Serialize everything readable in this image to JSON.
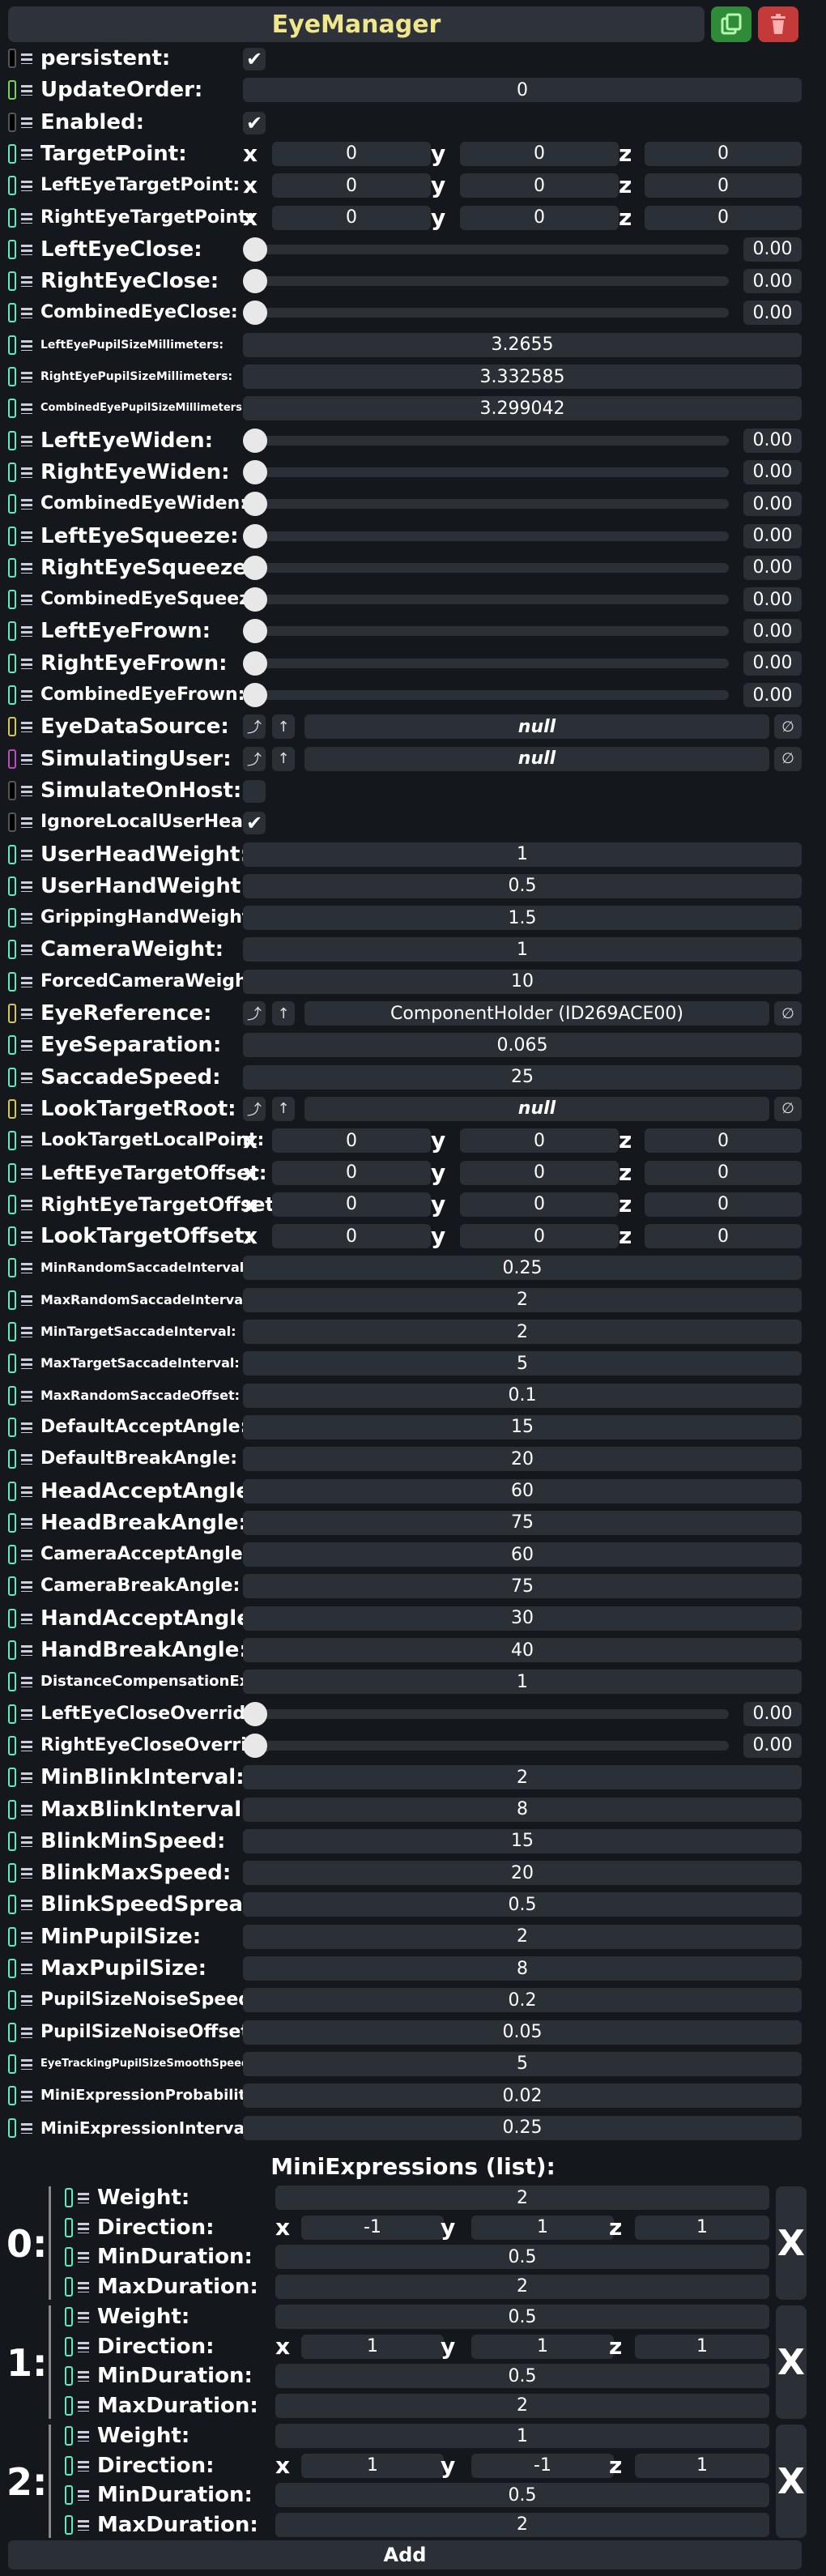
{
  "title": "EyeManager",
  "fields": [
    {
      "label": "persistent:",
      "kind": "check",
      "value": "✔",
      "sw": "#777",
      "fs": 26
    },
    {
      "label": "UpdateOrder:",
      "kind": "num",
      "value": "0",
      "sw": "#7cd44a",
      "fs": 26
    },
    {
      "label": "Enabled:",
      "kind": "check",
      "value": "✔",
      "sw": "#777",
      "fs": 26
    },
    {
      "label": "TargetPoint:",
      "kind": "vec",
      "x": "0",
      "y": "0",
      "z": "0",
      "fs": 26
    },
    {
      "label": "LeftEyeTargetPoint:",
      "kind": "vec",
      "x": "0",
      "y": "0",
      "z": "0",
      "fs": 22
    },
    {
      "label": "RightEyeTargetPoint:",
      "kind": "vec",
      "x": "0",
      "y": "0",
      "z": "0",
      "fs": 22
    },
    {
      "label": "LeftEyeClose:",
      "kind": "slider",
      "value": "0.00",
      "fs": 26
    },
    {
      "label": "RightEyeClose:",
      "kind": "slider",
      "value": "0.00",
      "fs": 26
    },
    {
      "label": "CombinedEyeClose:",
      "kind": "slider",
      "value": "0.00",
      "fs": 22
    },
    {
      "label": "LeftEyePupilSizeMillimeters:",
      "kind": "num",
      "value": "3.2655",
      "fs": 14
    },
    {
      "label": "RightEyePupilSizeMillimeters:",
      "kind": "num",
      "value": "3.332585",
      "fs": 14
    },
    {
      "label": "CombinedEyePupilSizeMillimeters:",
      "kind": "num",
      "value": "3.299042",
      "fs": 13
    },
    {
      "label": "LeftEyeWiden:",
      "kind": "slider",
      "value": "0.00",
      "fs": 26
    },
    {
      "label": "RightEyeWiden:",
      "kind": "slider",
      "value": "0.00",
      "fs": 26
    },
    {
      "label": "CombinedEyeWiden:",
      "kind": "slider",
      "value": "0.00",
      "fs": 22
    },
    {
      "label": "LeftEyeSqueeze:",
      "kind": "slider",
      "value": "0.00",
      "fs": 26
    },
    {
      "label": "RightEyeSqueeze:",
      "kind": "slider",
      "value": "0.00",
      "fs": 26
    },
    {
      "label": "CombinedEyeSqueeze:",
      "kind": "slider",
      "value": "0.00",
      "fs": 22
    },
    {
      "label": "LeftEyeFrown:",
      "kind": "slider",
      "value": "0.00",
      "fs": 26
    },
    {
      "label": "RightEyeFrown:",
      "kind": "slider",
      "value": "0.00",
      "fs": 26
    },
    {
      "label": "CombinedEyeFrown:",
      "kind": "slider",
      "value": "0.00",
      "fs": 22
    },
    {
      "label": "EyeDataSource:",
      "kind": "ref",
      "value": "null",
      "sw": "#d6c94a",
      "fs": 26
    },
    {
      "label": "SimulatingUser:",
      "kind": "ref",
      "value": "null",
      "sw": "#c04ab8",
      "fs": 26
    },
    {
      "label": "SimulateOnHost:",
      "kind": "check",
      "value": "",
      "sw": "#777",
      "fs": 26
    },
    {
      "label": "IgnoreLocalUserHead:",
      "kind": "check",
      "value": "✔",
      "sw": "#777",
      "fs": 22
    },
    {
      "label": "UserHeadWeight:",
      "kind": "num",
      "value": "1",
      "fs": 26
    },
    {
      "label": "UserHandWeight:",
      "kind": "num",
      "value": "0.5",
      "fs": 26
    },
    {
      "label": "GrippingHandWeight:",
      "kind": "num",
      "value": "1.5",
      "fs": 22
    },
    {
      "label": "CameraWeight:",
      "kind": "num",
      "value": "1",
      "fs": 26
    },
    {
      "label": "ForcedCameraWeight:",
      "kind": "num",
      "value": "10",
      "fs": 22
    },
    {
      "label": "EyeReference:",
      "kind": "ref",
      "value": "ComponentHolder (ID269ACE00)",
      "sw": "#d6c94a",
      "fs": 26
    },
    {
      "label": "EyeSeparation:",
      "kind": "num",
      "value": "0.065",
      "fs": 26
    },
    {
      "label": "SaccadeSpeed:",
      "kind": "num",
      "value": "25",
      "fs": 26
    },
    {
      "label": "LookTargetRoot:",
      "kind": "ref",
      "value": "null",
      "sw": "#d6c94a",
      "fs": 26
    },
    {
      "label": "LookTargetLocalPoint:",
      "kind": "vec",
      "x": "0",
      "y": "0",
      "z": "0",
      "fs": 22
    },
    {
      "label": "LeftEyeTargetOffset:",
      "kind": "vec",
      "x": "0",
      "y": "0",
      "z": "0",
      "fs": 24
    },
    {
      "label": "RightEyeTargetOffset:",
      "kind": "vec",
      "x": "0",
      "y": "0",
      "z": "0",
      "fs": 24
    },
    {
      "label": "LookTargetOffset:",
      "kind": "vec",
      "x": "0",
      "y": "0",
      "z": "0",
      "fs": 26
    },
    {
      "label": "MinRandomSaccadeInterval:",
      "kind": "num",
      "value": "0.25",
      "fs": 16
    },
    {
      "label": "MaxRandomSaccadeInterval:",
      "kind": "num",
      "value": "2",
      "fs": 16
    },
    {
      "label": "MinTargetSaccadeInterval:",
      "kind": "num",
      "value": "2",
      "fs": 16
    },
    {
      "label": "MaxTargetSaccadeInterval:",
      "kind": "num",
      "value": "5",
      "fs": 16
    },
    {
      "label": "MaxRandomSaccadeOffset:",
      "kind": "num",
      "value": "0.1",
      "fs": 16
    },
    {
      "label": "DefaultAcceptAngle:",
      "kind": "num",
      "value": "15",
      "fs": 22
    },
    {
      "label": "DefaultBreakAngle:",
      "kind": "num",
      "value": "20",
      "fs": 22
    },
    {
      "label": "HeadAcceptAngle:",
      "kind": "num",
      "value": "60",
      "fs": 26
    },
    {
      "label": "HeadBreakAngle:",
      "kind": "num",
      "value": "75",
      "fs": 26
    },
    {
      "label": "CameraAcceptAngle:",
      "kind": "num",
      "value": "60",
      "fs": 22
    },
    {
      "label": "CameraBreakAngle:",
      "kind": "num",
      "value": "75",
      "fs": 22
    },
    {
      "label": "HandAcceptAngle:",
      "kind": "num",
      "value": "30",
      "fs": 26
    },
    {
      "label": "HandBreakAngle:",
      "kind": "num",
      "value": "40",
      "fs": 26
    },
    {
      "label": "DistanceCompensationExp:",
      "kind": "num",
      "value": "1",
      "fs": 18
    },
    {
      "label": "LeftEyeCloseOverride:",
      "kind": "slider",
      "value": "0.00",
      "fs": 22
    },
    {
      "label": "RightEyeCloseOverride:",
      "kind": "slider",
      "value": "0.00",
      "fs": 22
    },
    {
      "label": "MinBlinkInterval:",
      "kind": "num",
      "value": "2",
      "fs": 26
    },
    {
      "label": "MaxBlinkInterval:",
      "kind": "num",
      "value": "8",
      "fs": 26
    },
    {
      "label": "BlinkMinSpeed:",
      "kind": "num",
      "value": "15",
      "fs": 26
    },
    {
      "label": "BlinkMaxSpeed:",
      "kind": "num",
      "value": "20",
      "fs": 26
    },
    {
      "label": "BlinkSpeedSpread:",
      "kind": "num",
      "value": "0.5",
      "fs": 26
    },
    {
      "label": "MinPupilSize:",
      "kind": "num",
      "value": "2",
      "fs": 26
    },
    {
      "label": "MaxPupilSize:",
      "kind": "num",
      "value": "8",
      "fs": 26
    },
    {
      "label": "PupilSizeNoiseSpeed:",
      "kind": "num",
      "value": "0.2",
      "fs": 22
    },
    {
      "label": "PupilSizeNoiseOffset:",
      "kind": "num",
      "value": "0.05",
      "fs": 22
    },
    {
      "label": "EyeTrackingPupilSizeSmoothSpeed:",
      "kind": "num",
      "value": "5",
      "fs": 13
    },
    {
      "label": "MiniExpressionProbability:",
      "kind": "num",
      "value": "0.02",
      "fs": 18
    },
    {
      "label": "MiniExpressionInterval:",
      "kind": "num",
      "value": "0.25",
      "fs": 20
    }
  ],
  "list_title": "MiniExpressions (list):",
  "mini_expressions": [
    {
      "index": "0:",
      "weight": "2",
      "dir_x": "-1",
      "dir_y": "1",
      "dir_z": "1",
      "min_duration": "0.5",
      "max_duration": "2"
    },
    {
      "index": "1:",
      "weight": "0.5",
      "dir_x": "1",
      "dir_y": "1",
      "dir_z": "1",
      "min_duration": "0.5",
      "max_duration": "2"
    },
    {
      "index": "2:",
      "weight": "1",
      "dir_x": "1",
      "dir_y": "-1",
      "dir_z": "1",
      "min_duration": "0.5",
      "max_duration": "2"
    }
  ],
  "list_labels": {
    "weight": "Weight:",
    "direction": "Direction:",
    "min_duration": "MinDuration:",
    "max_duration": "MaxDuration:",
    "x": "x",
    "y": "y",
    "z": "z",
    "remove": "X"
  },
  "axis_labels": {
    "x": "x",
    "y": "y",
    "z": "z"
  },
  "ref_buttons": {
    "jump": "⤴",
    "up": "↑",
    "clear": "∅"
  },
  "add_label": "Add",
  "colors": {
    "accent": "#59eebe",
    "title": "#f0e68c",
    "panel": "#2d323b",
    "bg": "#14171c"
  }
}
